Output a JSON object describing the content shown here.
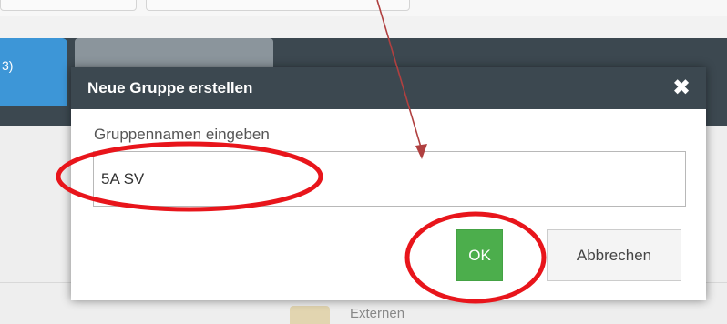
{
  "background": {
    "tab_label": "3)"
  },
  "dialog": {
    "title": "Neue Gruppe erstellen",
    "close_glyph": "✖",
    "field_label": "Gruppennamen eingeben",
    "name_value": "5A SV",
    "ok_label": "OK",
    "cancel_label": "Abbrechen"
  },
  "background_bottom": {
    "text": "Externen"
  },
  "colors": {
    "header_bg": "#3c4850",
    "ok_green": "#4cae4c",
    "tab_blue": "#3d96d7",
    "annotation_red": "#e8151b",
    "arrow_red": "#b04040"
  },
  "icons": {
    "close": "close-icon"
  }
}
